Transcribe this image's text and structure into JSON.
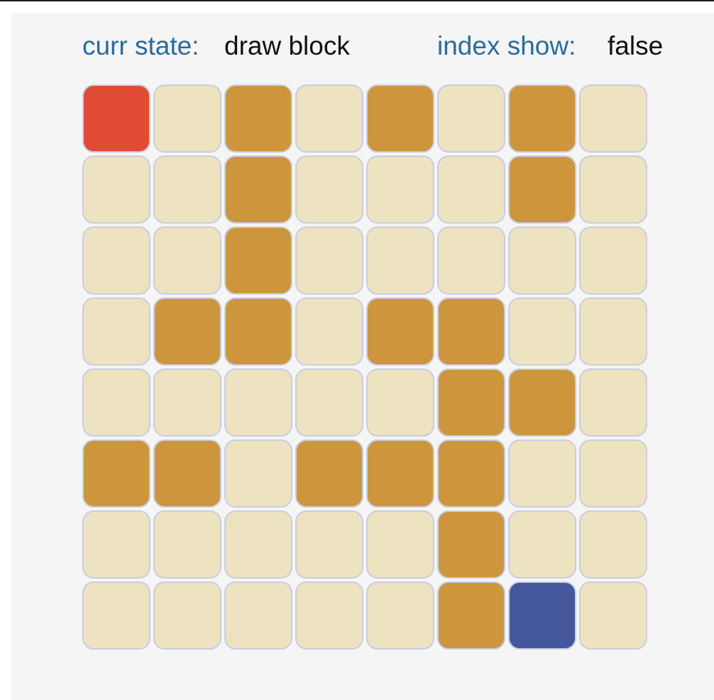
{
  "status": {
    "state_label": "curr state:",
    "state_value": "draw block",
    "index_label": "index show:",
    "index_value": "false"
  },
  "colors": {
    "empty": "#ede3c1",
    "block": "#cd963c",
    "start": "#e04c34",
    "end": "#44579c",
    "cell_border": "#c9cde0",
    "label": "#2b6b9a"
  },
  "grid": {
    "rows": 8,
    "cols": 8,
    "cells": [
      [
        "start",
        "empty",
        "block",
        "empty",
        "block",
        "empty",
        "block",
        "empty"
      ],
      [
        "empty",
        "empty",
        "block",
        "empty",
        "empty",
        "empty",
        "block",
        "empty"
      ],
      [
        "empty",
        "empty",
        "block",
        "empty",
        "empty",
        "empty",
        "empty",
        "empty"
      ],
      [
        "empty",
        "block",
        "block",
        "empty",
        "block",
        "block",
        "empty",
        "empty"
      ],
      [
        "empty",
        "empty",
        "empty",
        "empty",
        "empty",
        "block",
        "block",
        "empty"
      ],
      [
        "block",
        "block",
        "empty",
        "block",
        "block",
        "block",
        "empty",
        "empty"
      ],
      [
        "empty",
        "empty",
        "empty",
        "empty",
        "empty",
        "block",
        "empty",
        "empty"
      ],
      [
        "empty",
        "empty",
        "empty",
        "empty",
        "empty",
        "block",
        "end",
        "empty"
      ]
    ]
  }
}
